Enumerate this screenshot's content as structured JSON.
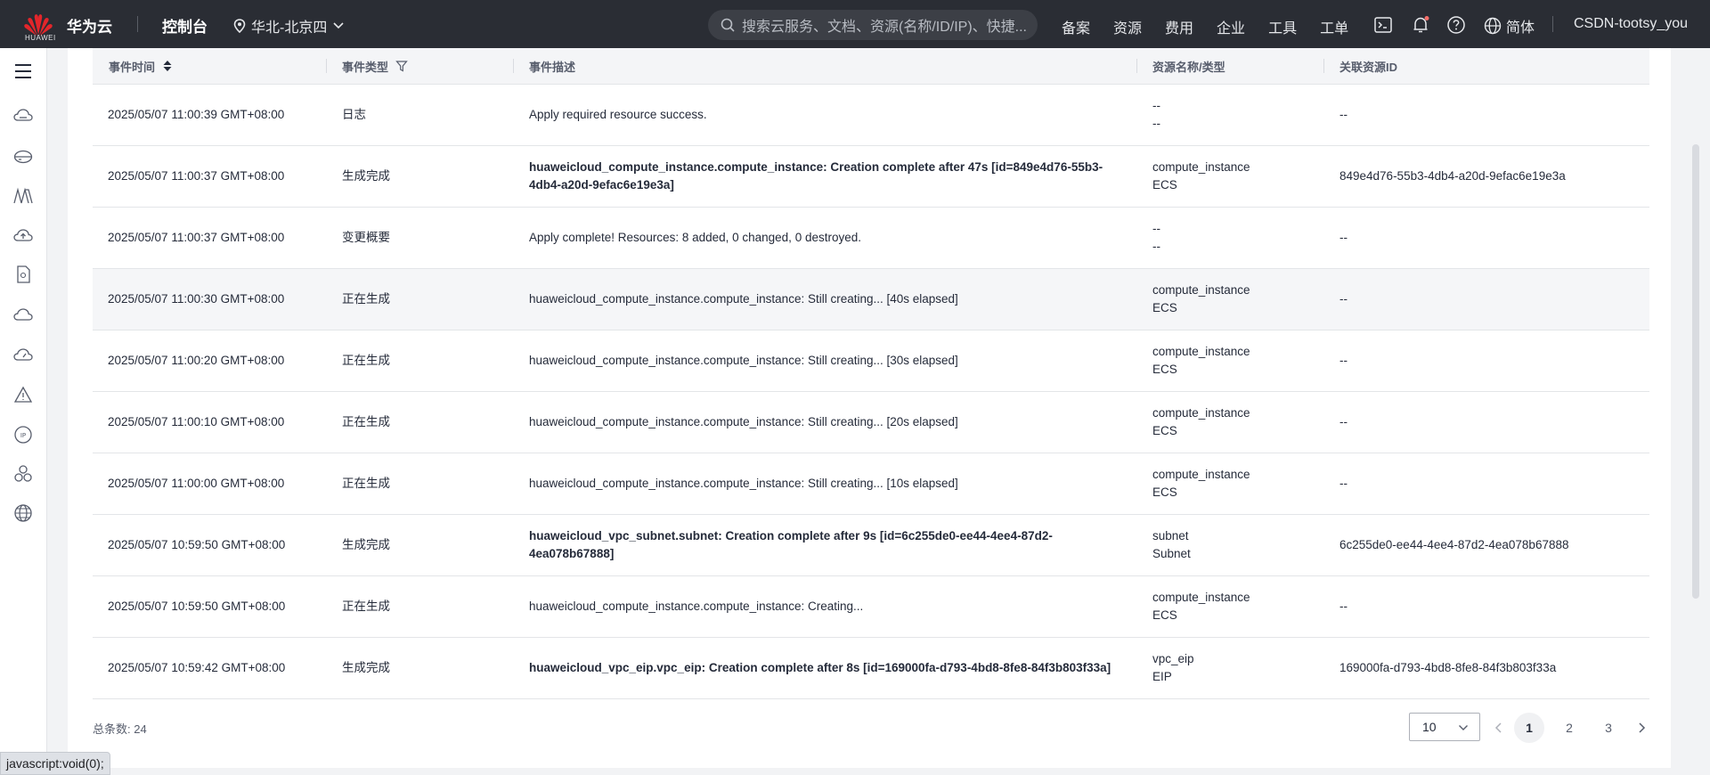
{
  "topbar": {
    "logo_text": "HUAWEI",
    "brand": "华为云",
    "console": "控制台",
    "region": "华北-北京四",
    "search_placeholder": "搜索云服务、文档、资源(名称/ID/IP)、快捷...",
    "nav": [
      "备案",
      "资源",
      "费用",
      "企业",
      "工具",
      "工单"
    ],
    "language": "简体",
    "user": "CSDN-tootsy_you",
    "notification_dot_color": "#f66f6a"
  },
  "sidebar": {
    "icons": [
      "menu-icon",
      "cloud-server-icon",
      "disk-icon",
      "network-icon",
      "cloud-upload-icon",
      "sim-card-icon",
      "cloud-icon",
      "dashboard-icon",
      "warning-icon",
      "ip-icon",
      "cluster-icon",
      "globe-icon"
    ]
  },
  "table": {
    "headers": {
      "time": "事件时间",
      "type": "事件类型",
      "desc": "事件描述",
      "resource": "资源名称/类型",
      "id": "关联资源ID"
    },
    "rows": [
      {
        "time": "2025/05/07 11:00:39 GMT+08:00",
        "type": "日志",
        "status": "normal",
        "desc": "Apply required resource success.",
        "res_name": "--",
        "res_type": "--",
        "res_id": "--"
      },
      {
        "time": "2025/05/07 11:00:37 GMT+08:00",
        "type": "生成完成",
        "status": "ok",
        "desc": "huaweicloud_compute_instance.compute_instance: Creation complete after 47s [id=849e4d76-55b3-4db4-a20d-9efac6e19e3a]",
        "res_name": "compute_instance",
        "res_type": "ECS",
        "res_id": "849e4d76-55b3-4db4-a20d-9efac6e19e3a"
      },
      {
        "time": "2025/05/07 11:00:37 GMT+08:00",
        "type": "变更概要",
        "status": "normal",
        "desc": "Apply complete! Resources: 8 added, 0 changed, 0 destroyed.",
        "res_name": "--",
        "res_type": "--",
        "res_id": "--"
      },
      {
        "time": "2025/05/07 11:00:30 GMT+08:00",
        "type": "正在生成",
        "status": "normal",
        "desc": "huaweicloud_compute_instance.compute_instance: Still creating... [40s elapsed]",
        "res_name": "compute_instance",
        "res_type": "ECS",
        "res_id": "--"
      },
      {
        "time": "2025/05/07 11:00:20 GMT+08:00",
        "type": "正在生成",
        "status": "normal",
        "desc": "huaweicloud_compute_instance.compute_instance: Still creating... [30s elapsed]",
        "res_name": "compute_instance",
        "res_type": "ECS",
        "res_id": "--"
      },
      {
        "time": "2025/05/07 11:00:10 GMT+08:00",
        "type": "正在生成",
        "status": "normal",
        "desc": "huaweicloud_compute_instance.compute_instance: Still creating... [20s elapsed]",
        "res_name": "compute_instance",
        "res_type": "ECS",
        "res_id": "--"
      },
      {
        "time": "2025/05/07 11:00:00 GMT+08:00",
        "type": "正在生成",
        "status": "normal",
        "desc": "huaweicloud_compute_instance.compute_instance: Still creating... [10s elapsed]",
        "res_name": "compute_instance",
        "res_type": "ECS",
        "res_id": "--"
      },
      {
        "time": "2025/05/07 10:59:50 GMT+08:00",
        "type": "生成完成",
        "status": "ok",
        "desc": "huaweicloud_vpc_subnet.subnet: Creation complete after 9s [id=6c255de0-ee44-4ee4-87d2-4ea078b67888]",
        "res_name": "subnet",
        "res_type": "Subnet",
        "res_id": "6c255de0-ee44-4ee4-87d2-4ea078b67888"
      },
      {
        "time": "2025/05/07 10:59:50 GMT+08:00",
        "type": "正在生成",
        "status": "normal",
        "desc": "huaweicloud_compute_instance.compute_instance: Creating...",
        "res_name": "compute_instance",
        "res_type": "ECS",
        "res_id": "--"
      },
      {
        "time": "2025/05/07 10:59:42 GMT+08:00",
        "type": "生成完成",
        "status": "ok",
        "desc": "huaweicloud_vpc_eip.vpc_eip: Creation complete after 8s [id=169000fa-d793-4bd8-8fe8-84f3b803f33a]",
        "res_name": "vpc_eip",
        "res_type": "EIP",
        "res_id": "169000fa-d793-4bd8-8fe8-84f3b803f33a"
      }
    ],
    "highlight_row": 3
  },
  "footer": {
    "total_label": "总条数:",
    "total": "24",
    "page_size": "10",
    "pages": [
      "1",
      "2",
      "3"
    ],
    "current_page": "1"
  },
  "statusbar": "javascript:void(0);",
  "colors": {
    "topbar": "#2a2d34",
    "success": "#5eb526",
    "brand_red": "#e3262b"
  }
}
